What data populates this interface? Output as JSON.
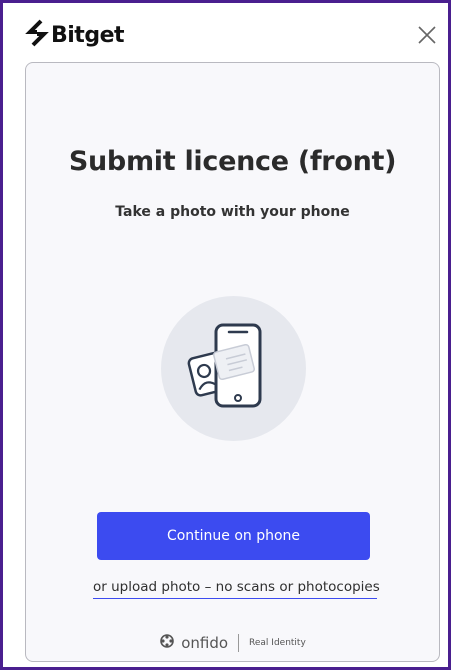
{
  "header": {
    "brand_name": "Bitget",
    "brand_icon": "bitget-logo-icon",
    "close_icon": "close-icon"
  },
  "main": {
    "title": "Submit licence (front)",
    "subtitle": "Take a photo with your phone",
    "illustration_icon": "phone-with-id-card-icon",
    "continue_label": "Continue on phone",
    "upload_link": "or upload photo – no scans or photocopies"
  },
  "footer": {
    "provider": "onfido",
    "provider_icon": "onfido-logo-icon",
    "tagline": "Real Identity"
  },
  "colors": {
    "accent": "#3c4bf0",
    "window_border": "#4a1f8f",
    "panel_background": "#f8f8fb"
  }
}
